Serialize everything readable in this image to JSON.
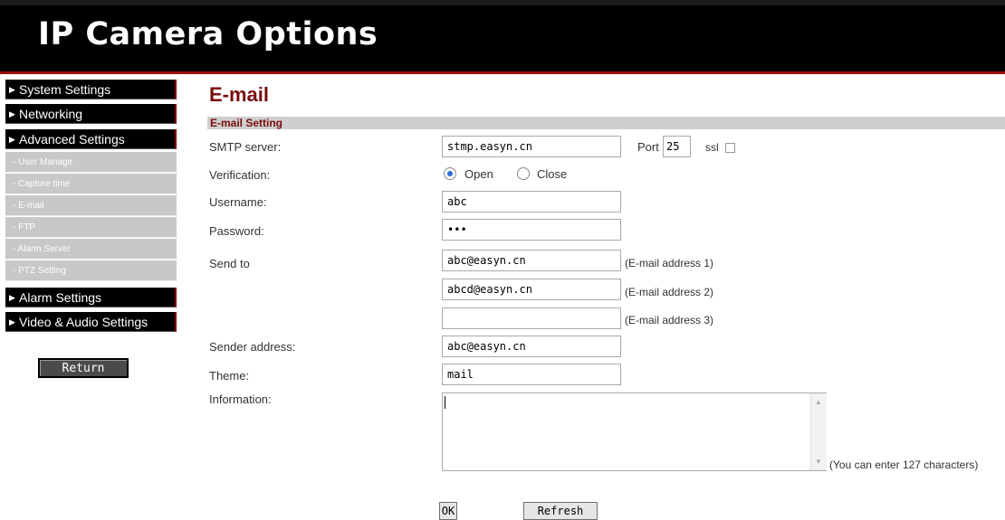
{
  "header": {
    "title": "IP Camera Options"
  },
  "sidebar": {
    "main_items": [
      {
        "label": "System Settings"
      },
      {
        "label": "Networking"
      },
      {
        "label": "Advanced Settings"
      },
      {
        "label": "Alarm Settings"
      },
      {
        "label": "Video & Audio Settings"
      }
    ],
    "sub_items": [
      {
        "label": "- User Manage"
      },
      {
        "label": "- Capture time"
      },
      {
        "label": "- E-mail"
      },
      {
        "label": "- FTP"
      },
      {
        "label": "- Alarm Server"
      },
      {
        "label": "- PTZ Setting"
      }
    ],
    "return_label": "Return",
    "arrow_icon": "▶"
  },
  "main": {
    "title": "E-mail",
    "section_title": "E-mail Setting",
    "fields": {
      "smtp_label": "SMTP server:",
      "smtp_value": "stmp.easyn.cn",
      "port_label": "Port",
      "port_value": "25",
      "ssl_label": "ssl",
      "ssl_checked": false,
      "verification_label": "Verification:",
      "verification_options": [
        "Open",
        "Close"
      ],
      "verification_selected": "Open",
      "username_label": "Username:",
      "username_value": "abc",
      "password_label": "Password:",
      "password_value": "abc",
      "sendto_label": "Send to",
      "sendto_values": [
        "abc@easyn.cn",
        "abcd@easyn.cn",
        ""
      ],
      "sendto_hints": [
        "(E-mail address 1)",
        "(E-mail address 2)",
        "(E-mail address 3)"
      ],
      "sender_label": "Sender address:",
      "sender_value": "abc@easyn.cn",
      "theme_label": "Theme:",
      "theme_value": "mail",
      "information_label": "Information:",
      "information_value": "",
      "information_hint": "(You can enter 127 characters)"
    },
    "ok_label": "OK",
    "refresh_label": "Refresh"
  },
  "colors": {
    "accent": "#7a0d0d",
    "header_bg": "#000000",
    "section_bar": "#cfcfcf",
    "sub_nav_bg": "#c8c8c8"
  }
}
